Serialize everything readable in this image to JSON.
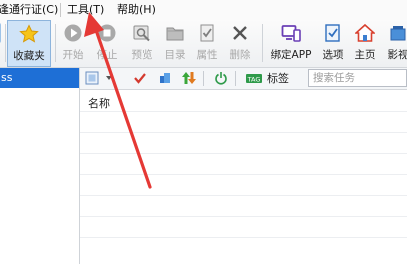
{
  "menu": {
    "items": [
      {
        "label": "逢通行证(C)"
      },
      {
        "label": "工具(T)"
      },
      {
        "label": "帮助(H)"
      }
    ]
  },
  "toolbar": {
    "buttons": [
      {
        "label": "收藏夹",
        "icon": "star-icon",
        "enabled": true
      },
      {
        "label": "开始",
        "icon": "play-icon",
        "enabled": false
      },
      {
        "label": "停止",
        "icon": "stop-icon",
        "enabled": false
      },
      {
        "label": "预览",
        "icon": "preview-icon",
        "enabled": false
      },
      {
        "label": "目录",
        "icon": "folder-icon",
        "enabled": false
      },
      {
        "label": "属性",
        "icon": "properties-icon",
        "enabled": false
      },
      {
        "label": "删除",
        "icon": "delete-icon",
        "enabled": false
      },
      {
        "label": "绑定APP",
        "icon": "bind-app-icon",
        "enabled": true
      },
      {
        "label": "选项",
        "icon": "options-icon",
        "enabled": true
      },
      {
        "label": "主页",
        "icon": "home-icon",
        "enabled": true
      },
      {
        "label": "影视",
        "icon": "film-icon",
        "enabled": true
      }
    ]
  },
  "left_panel": {
    "header": "ss"
  },
  "sub_toolbar": {
    "tag_label": "标签",
    "search_placeholder": "搜索任务"
  },
  "list": {
    "column_name": "名称"
  },
  "colors": {
    "selection_blue": "#1e6fd6",
    "annotation_red": "#e53935"
  }
}
